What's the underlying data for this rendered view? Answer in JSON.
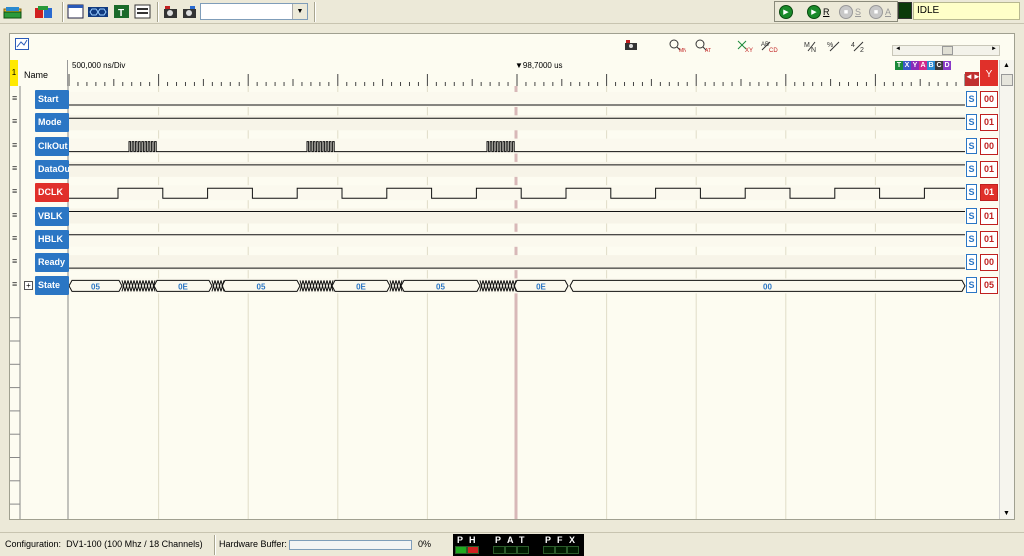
{
  "toolbar": {
    "icons": [
      "open-folder-icon",
      "save-icon",
      "window-icon",
      "bus-icon",
      "text-icon",
      "list-icon",
      "capture-settings-icon",
      "trigger-settings-icon"
    ],
    "combo_value": ""
  },
  "run_controls": {
    "run_label": "",
    "r_label": "R",
    "s_label": "S",
    "a_label": "A",
    "status": "IDLE"
  },
  "panel": {
    "time_per_div": "500,000 ns/Div",
    "cursor_time": "98,7000 us",
    "name_header": "Name",
    "row_marker": "1",
    "value_header": "Y",
    "legend": [
      "T",
      "X",
      "Y",
      "A",
      "B",
      "C",
      "D"
    ],
    "legend_colors": [
      "#1a8a3a",
      "#3a5ac8",
      "#8a2ab8",
      "#d02a8a",
      "#2a8ad0",
      "#3a3a3a",
      "#8a3ac8"
    ],
    "tools": [
      "marker-icon",
      "zoom-in-out-icon",
      "zoom-fit-icon",
      "xy-icon",
      "cd-icon",
      "go-start-icon",
      "go-mid-icon",
      "go-end-icon"
    ]
  },
  "signals": [
    {
      "name": "Start",
      "value": "00",
      "highlight": false
    },
    {
      "name": "Mode",
      "value": "01",
      "highlight": false
    },
    {
      "name": "ClkOut",
      "value": "00",
      "highlight": false
    },
    {
      "name": "DataOu",
      "value": "01",
      "highlight": false
    },
    {
      "name": "DCLK",
      "value": "01",
      "highlight": true
    },
    {
      "name": "VBLK",
      "value": "01",
      "highlight": false
    },
    {
      "name": "HBLK",
      "value": "01",
      "highlight": false
    },
    {
      "name": "Ready",
      "value": "00",
      "highlight": false
    },
    {
      "name": "State",
      "value": "05",
      "highlight": false,
      "is_bus": true
    }
  ],
  "bus_state_labels": [
    "05",
    "0E",
    "05",
    "0E",
    "05",
    "0E",
    "00"
  ],
  "status_bar": {
    "configuration_label": "Configuration:",
    "configuration_value": "DV1-100 (100 Mhz / 18 Channels)",
    "hw_buffer_label": "Hardware Buffer:",
    "hw_buffer_pct": "0%",
    "hw_buffer_fill": 0,
    "led_labels": [
      "P",
      "H",
      "P",
      "A",
      "T",
      "P",
      "F",
      "X"
    ]
  }
}
